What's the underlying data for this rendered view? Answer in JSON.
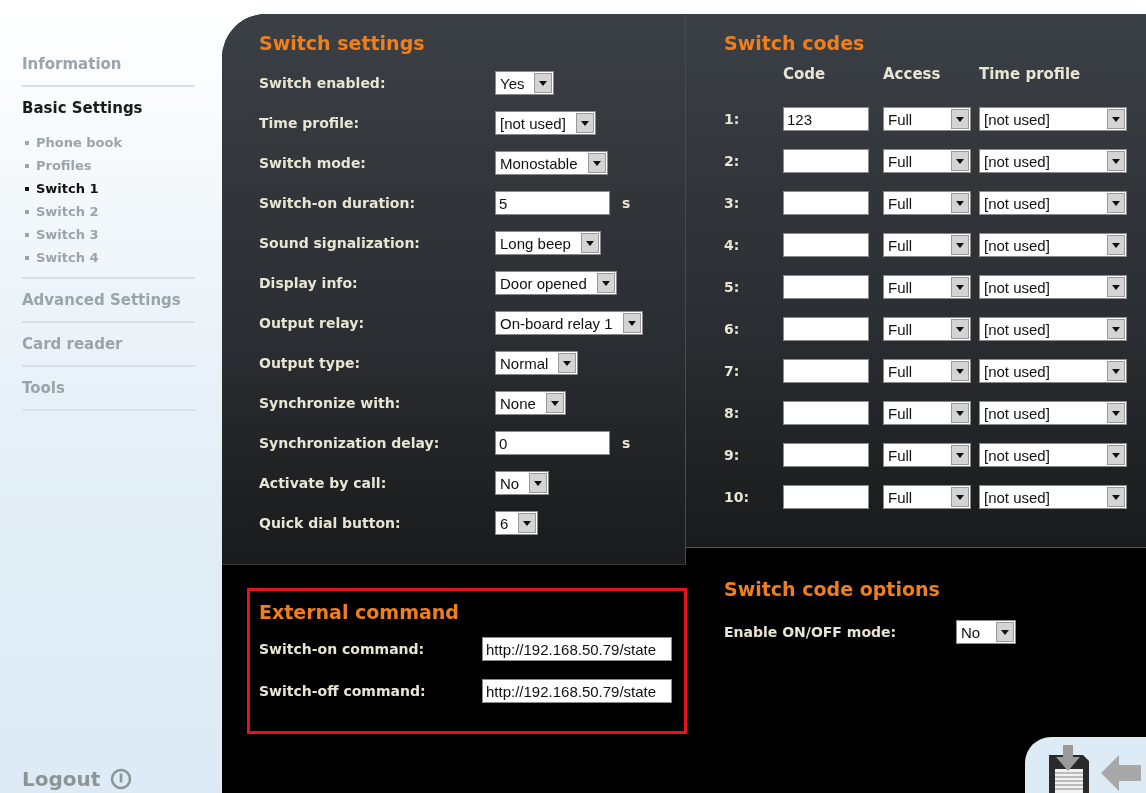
{
  "sidebar": {
    "items": [
      {
        "label": "Information",
        "selected": false
      },
      {
        "label": "Basic Settings",
        "selected": true,
        "children": [
          {
            "label": "Phone book",
            "selected": false
          },
          {
            "label": "Profiles",
            "selected": false
          },
          {
            "label": "Switch 1",
            "selected": true
          },
          {
            "label": "Switch 2",
            "selected": false
          },
          {
            "label": "Switch 3",
            "selected": false
          },
          {
            "label": "Switch 4",
            "selected": false
          }
        ]
      },
      {
        "label": "Advanced Settings",
        "selected": false
      },
      {
        "label": "Card reader",
        "selected": false
      },
      {
        "label": "Tools",
        "selected": false
      }
    ],
    "logout": {
      "label": "Logout"
    }
  },
  "switch_settings": {
    "title": "Switch settings",
    "rows": [
      {
        "label": "Switch enabled:",
        "kind": "select",
        "value": "Yes"
      },
      {
        "label": "Time profile:",
        "kind": "select",
        "value": "[not used]"
      },
      {
        "label": "Switch mode:",
        "kind": "select",
        "value": "Monostable"
      },
      {
        "label": "Switch-on duration:",
        "kind": "input",
        "value": "5",
        "unit": "s"
      },
      {
        "label": "Sound signalization:",
        "kind": "select",
        "value": "Long beep"
      },
      {
        "label": "Display info:",
        "kind": "select",
        "value": "Door opened"
      },
      {
        "label": "Output relay:",
        "kind": "select",
        "value": "On-board relay 1"
      },
      {
        "label": "Output type:",
        "kind": "select",
        "value": "Normal"
      },
      {
        "label": "Synchronize with:",
        "kind": "select",
        "value": "None"
      },
      {
        "label": "Synchronization delay:",
        "kind": "input",
        "value": "0",
        "unit": "s"
      },
      {
        "label": "Activate by call:",
        "kind": "select",
        "value": "No"
      },
      {
        "label": "Quick dial button:",
        "kind": "select",
        "value": "6"
      }
    ]
  },
  "external_command": {
    "title": "External command",
    "rows": [
      {
        "label": "Switch-on command:",
        "value": "http://192.168.50.79/state"
      },
      {
        "label": "Switch-off command:",
        "value": "http://192.168.50.79/state"
      }
    ]
  },
  "switch_codes": {
    "title": "Switch codes",
    "columns": [
      "Code",
      "Access",
      "Time profile"
    ],
    "rows": [
      {
        "number": "1:",
        "code": "123",
        "access": "Full",
        "time_profile": "[not used]"
      },
      {
        "number": "2:",
        "access": "Full",
        "time_profile": "[not used]"
      },
      {
        "number": "3:",
        "access": "Full",
        "time_profile": "[not used]"
      },
      {
        "number": "4:",
        "access": "Full",
        "time_profile": "[not used]"
      },
      {
        "number": "5:",
        "access": "Full",
        "time_profile": "[not used]"
      },
      {
        "number": "6:",
        "access": "Full",
        "time_profile": "[not used]"
      },
      {
        "number": "7:",
        "access": "Full",
        "time_profile": "[not used]"
      },
      {
        "number": "8:",
        "access": "Full",
        "time_profile": "[not used]"
      },
      {
        "number": "9:",
        "access": "Full",
        "time_profile": "[not used]"
      },
      {
        "number": "10:",
        "access": "Full",
        "time_profile": "[not used]"
      }
    ]
  },
  "switch_code_options": {
    "title": "Switch code options",
    "rows": [
      {
        "label": "Enable ON/OFF mode:",
        "value": "No"
      }
    ]
  }
}
